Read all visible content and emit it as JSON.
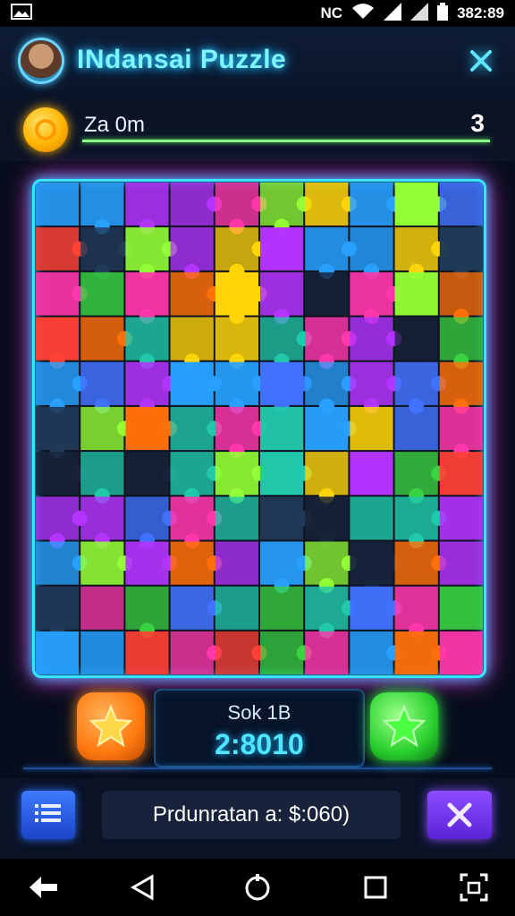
{
  "status_bar": {
    "time": "382:89",
    "indicator": "NC"
  },
  "header": {
    "title": "INdansai Puzzle"
  },
  "score": {
    "label": "Za 0m",
    "value": "3"
  },
  "timer": {
    "label": "Sok 1B",
    "value": "2:8010"
  },
  "footer": {
    "info_text": "Prdunratan a:  $:060)"
  },
  "colors": {
    "accent": "#36e5ff",
    "title_glow": "#7df4ff",
    "board_glow_pink": "#ff37e8",
    "orange_button": "#ff7a10",
    "green_button": "#2ad12e",
    "close_button": "#7a3bff"
  },
  "puzzle": {
    "cols": 10,
    "rows": 11,
    "palette": [
      "#ff6a00",
      "#ffd400",
      "#8fff2d",
      "#31d13a",
      "#18c7a8",
      "#1f9dff",
      "#3a6dff",
      "#b12cff",
      "#ff2fa8",
      "#ff3a2e",
      "#0e1b33",
      "#173252"
    ]
  },
  "icons": {
    "avatar": "avatar-icon",
    "top_close": "close-icon",
    "coin": "coin-icon",
    "orange_star": "star-icon",
    "green_star": "star-icon",
    "menu": "list-icon",
    "close": "close-x-icon",
    "nav": [
      "back-icon",
      "triangle-back-icon",
      "home-icon",
      "recents-icon",
      "screenshot-icon"
    ]
  }
}
